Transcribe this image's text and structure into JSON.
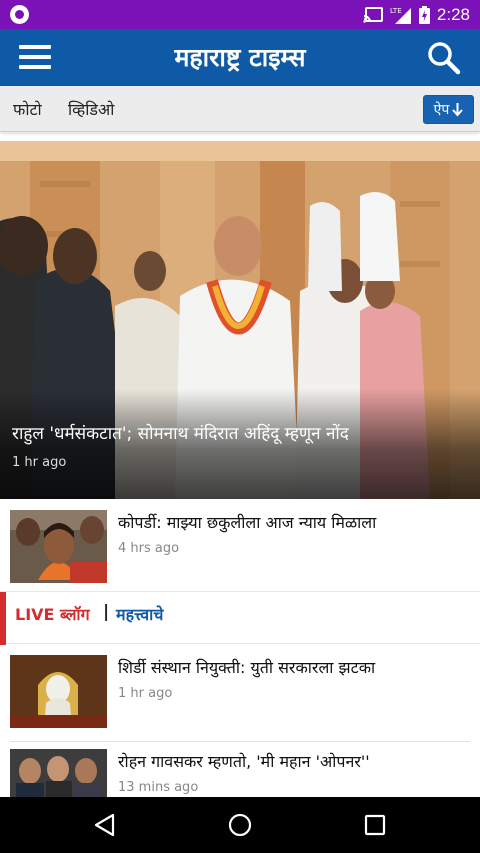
{
  "status_bar": {
    "time": "2:28",
    "icons": [
      "notification-icon",
      "cast-icon",
      "lte-signal-icon",
      "battery-icon"
    ]
  },
  "header": {
    "brand": "महाराष्ट्र टाइम्स",
    "menu_icon": "hamburger-menu-icon",
    "search_icon": "search-icon",
    "color": "#0f5aa7"
  },
  "tabs": [
    {
      "label": "फोटो"
    },
    {
      "label": "व्हिडिओ"
    }
  ],
  "app_button": {
    "label": "ऐप",
    "icon": "download-arrow-icon"
  },
  "hero": {
    "title": "राहुल 'धर्मसंकटात'; सोमनाथ मंदिरात अहिंदू म्हणून नोंद",
    "time": "1 hr ago"
  },
  "stories": [
    {
      "title": "कोपर्डी: माझ्या छकुलीला आज न्याय मिळाला",
      "time": "4 hrs ago"
    },
    {
      "title": "शिर्डी संस्थान नियुक्ती: युती सरकारला झटका",
      "time": "1 hr ago"
    },
    {
      "title": "रोहन गावसकर म्हणतो, 'मी महान 'ओपनर''",
      "time": "13 mins ago"
    }
  ],
  "live_bar": {
    "live_label": "LIVE ब्लॉग",
    "separator": "|",
    "important_label": "महत्त्वाचे",
    "live_color": "#d32d2d"
  },
  "nav": {
    "back_icon": "back-triangle-icon",
    "home_icon": "home-circle-icon",
    "recents_icon": "recents-square-icon"
  }
}
